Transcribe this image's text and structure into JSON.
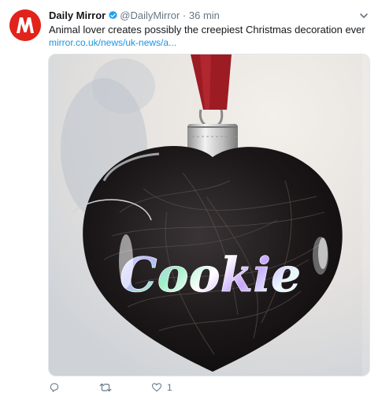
{
  "account": {
    "name": "Daily Mirror",
    "handle": "@DailyMirror",
    "separator": "·",
    "time": "36 min",
    "verified": true,
    "avatar_letter": "M",
    "brand_color": "#e2231a"
  },
  "tweet": {
    "text": "Animal lover creates possibly the creepiest Christmas decoration ever",
    "link": "mirror.co.uk/news/uk-news/a..."
  },
  "media": {
    "ornament_text": "Cookie",
    "colors": {
      "ribbon": "#9d1b23",
      "cap": "#c8c8c8",
      "glass": "#1a1617"
    }
  },
  "actions": {
    "reply_icon": "reply-icon",
    "retweet_icon": "retweet-icon",
    "like_icon": "heart-icon",
    "like_count": "1"
  },
  "colors": {
    "link": "#1b95e0",
    "meta": "#657786",
    "verified": "#1da1f2"
  }
}
